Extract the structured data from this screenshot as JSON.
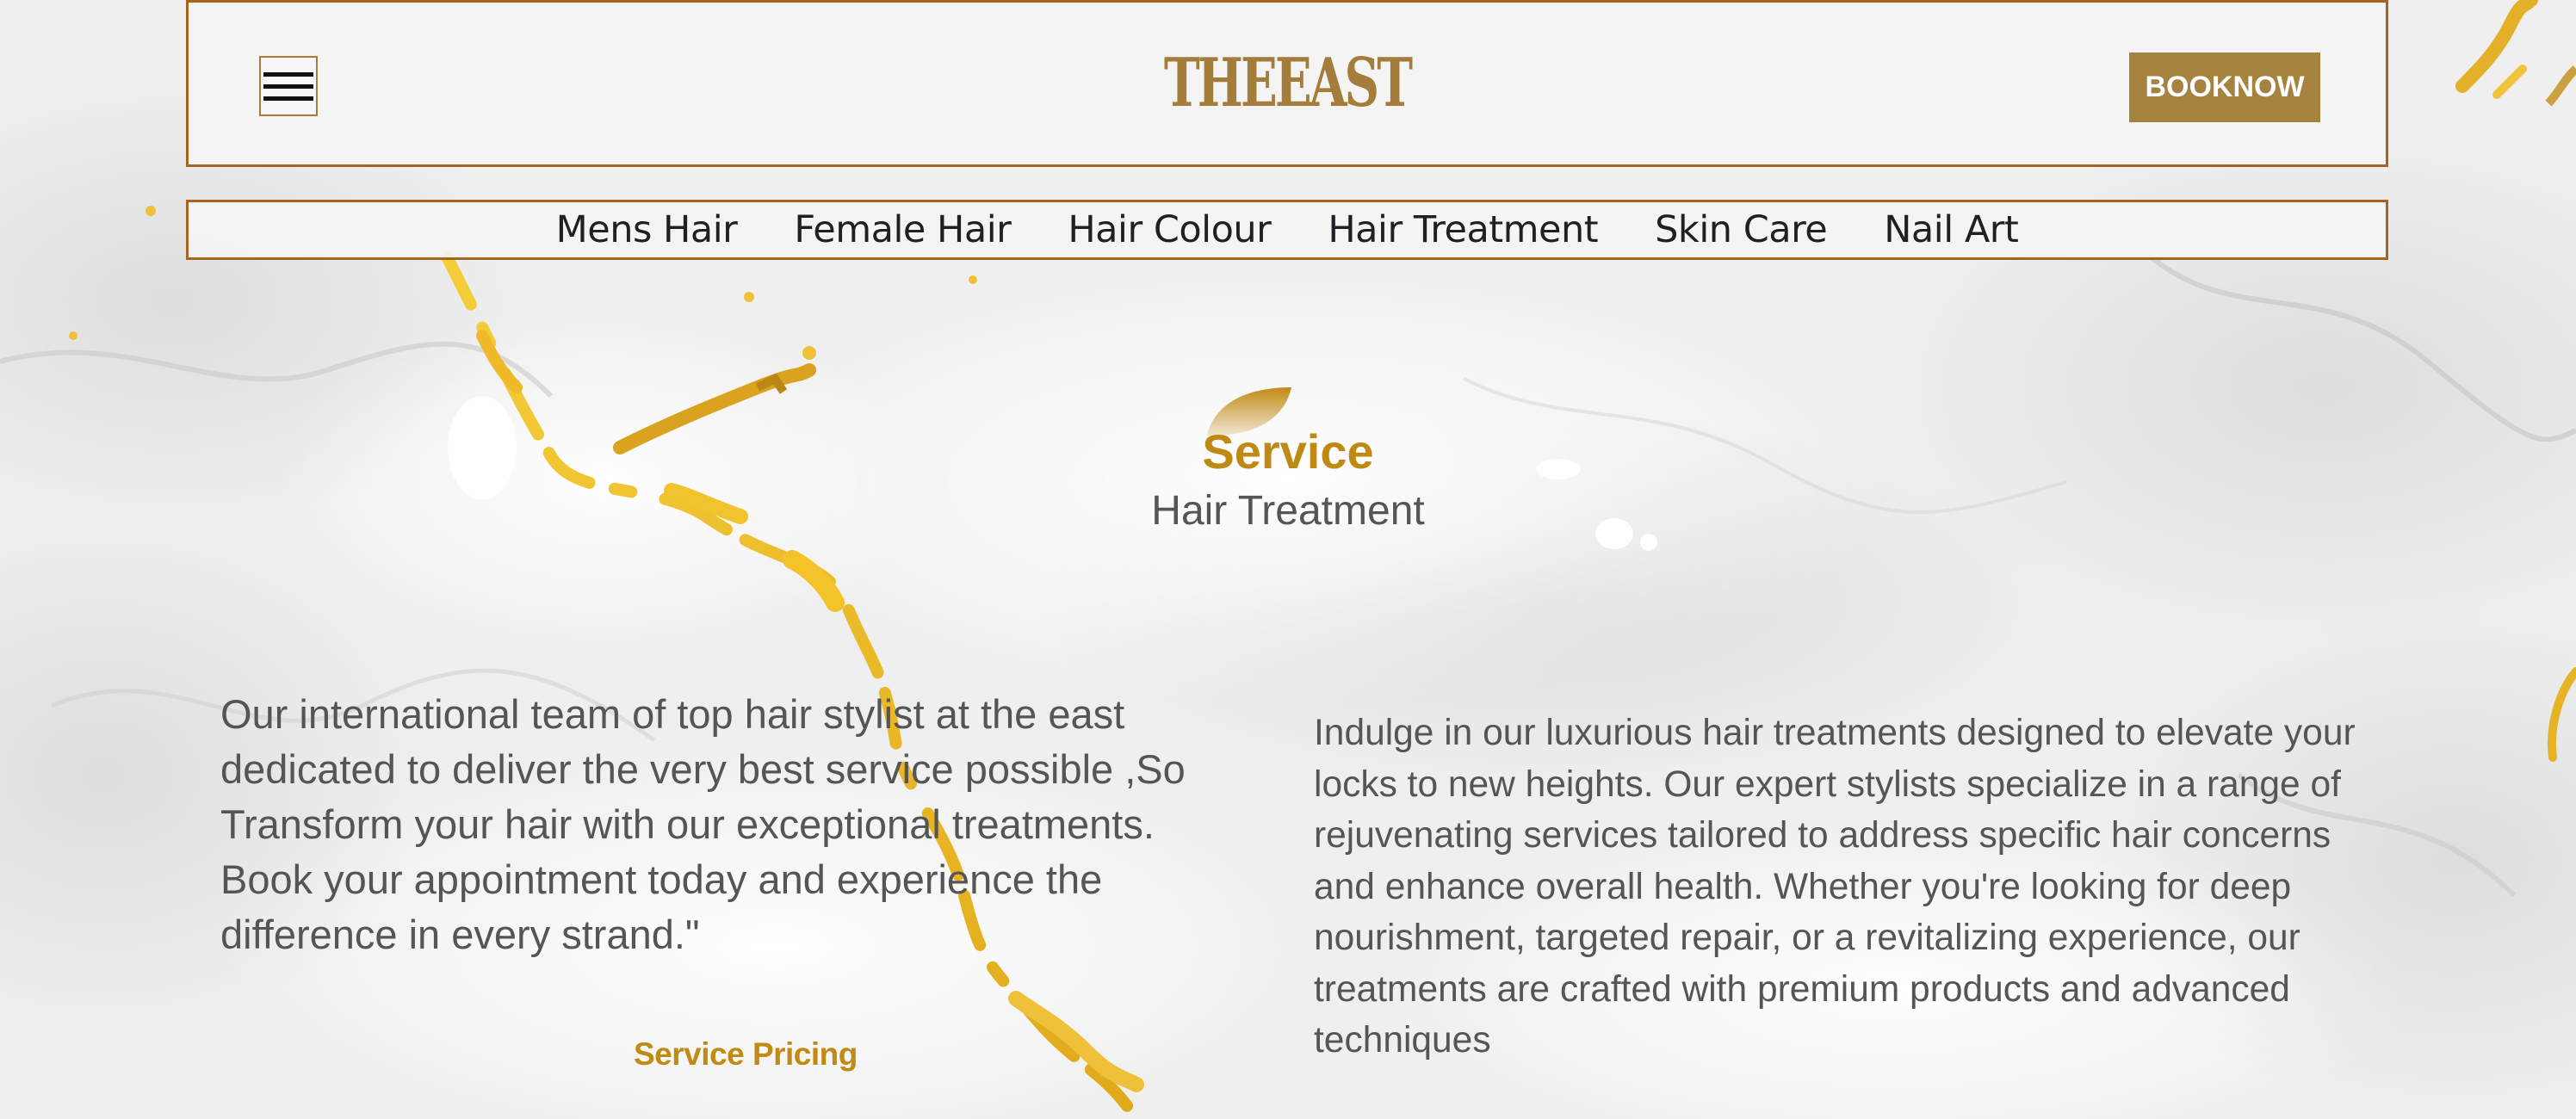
{
  "header": {
    "logo": "THEEAST",
    "book_label": "BOOKNOW",
    "menu_icon": "hamburger-menu-icon"
  },
  "nav": {
    "items": [
      {
        "label": "Mens Hair"
      },
      {
        "label": "Female Hair"
      },
      {
        "label": "Hair Colour"
      },
      {
        "label": "Hair Treatment"
      },
      {
        "label": "Skin Care"
      },
      {
        "label": "Nail Art"
      }
    ]
  },
  "section": {
    "title": "Service",
    "subtitle": "Hair Treatment",
    "leaf_icon": "leaf-icon",
    "left_text": "Our international team of top hair stylist at the east dedicated to deliver the very best service possible ,So Transform your hair with our exceptional treatments. Book your appointment today and experience the difference in every strand.\"",
    "pricing_link": "Service Pricing",
    "right_text": "Indulge in our luxurious hair treatments designed to elevate your locks to new heights. Our expert stylists specialize in a range of rejuvenating services tailored to address specific hair concerns and enhance overall health. Whether you're looking for deep nourishment, targeted repair, or a revitalizing experience, our treatments are crafted with premium products and advanced techniques"
  },
  "colors": {
    "accent_gold": "#c08a13",
    "button_gold": "#a6823f",
    "border_brown": "#a6651f",
    "text_gray": "#555555"
  }
}
